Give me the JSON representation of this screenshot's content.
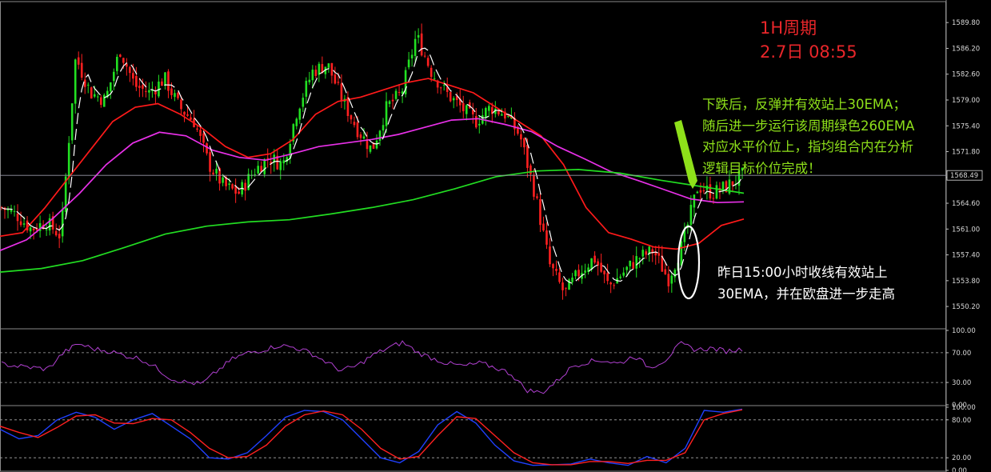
{
  "title": {
    "period": "1H周期",
    "timestamp": "2.7日 08:55"
  },
  "notes": {
    "green": [
      "下跌后，反弹并有效站上30EMA；",
      "随后进一步运行该周期绿色260EMA",
      "对应水平价位上，指均组合内在分析",
      "逻辑目标价位完成！"
    ],
    "white": [
      "昨日15:00小时收线有效站上",
      "30EMA，并在欧盘进一步走高"
    ]
  },
  "colors": {
    "background": "#000000",
    "bull_candle": "#22e022",
    "bear_candle": "#ff2020",
    "ema30": "#ff1a1a",
    "ema_magenta": "#e830e8",
    "ema260": "#22dd22",
    "rsi": "#b040d0",
    "kdj_k": "#2040ff",
    "kdj_d": "#ff2020",
    "green_note": "#8ee01a",
    "title": "#e8262a"
  },
  "chart_data": [
    {
      "type": "candlestick",
      "panel": "price",
      "instrument_timeframe": "1H",
      "ylim": [
        1547.2,
        1592.5
      ],
      "y_ticks": [
        "1589.80",
        "1586.20",
        "1582.60",
        "1579.00",
        "1575.40",
        "1571.80",
        "1568.20",
        "1564.60",
        "1561.00",
        "1557.40",
        "1553.80",
        "1550.20"
      ],
      "current_price": "1568.49",
      "close_path": [
        1564,
        1563,
        1561,
        1562,
        1560,
        1585,
        1580,
        1579,
        1586,
        1581,
        1580,
        1582,
        1578,
        1576,
        1570,
        1567,
        1566,
        1569,
        1571,
        1570,
        1578,
        1583,
        1584,
        1579,
        1575,
        1572,
        1578,
        1580,
        1588,
        1583,
        1580,
        1578,
        1576,
        1578,
        1577,
        1574,
        1566,
        1556,
        1552,
        1555,
        1557,
        1553,
        1555,
        1557,
        1558,
        1554,
        1559,
        1567,
        1566,
        1567,
        1568.5
      ],
      "series": [
        {
          "name": "30EMA",
          "values": [
            1560,
            1560.5,
            1564,
            1568,
            1572,
            1576,
            1578,
            1578.5,
            1577,
            1575,
            1572.5,
            1571,
            1571.5,
            1573.5,
            1577,
            1578.8,
            1579.4,
            1580.4,
            1581.4,
            1582,
            1581,
            1580,
            1578,
            1576,
            1574,
            1570,
            1564,
            1560.5,
            1559.6,
            1558.5,
            1558.2,
            1559,
            1561.5,
            1562.4
          ]
        },
        {
          "name": "magenta EMA",
          "values": [
            1558,
            1559.5,
            1562.5,
            1566,
            1570,
            1573,
            1574.5,
            1574,
            1572,
            1571,
            1570.6,
            1571.5,
            1572.5,
            1573,
            1573.5,
            1574.2,
            1575.2,
            1576.2,
            1576.4,
            1575.6,
            1574.6,
            1572.5,
            1570.8,
            1569,
            1567.8,
            1566.5,
            1565.2,
            1564.7,
            1564.8
          ]
        },
        {
          "name": "260EMA",
          "values": [
            1555,
            1555.5,
            1556.6,
            1558.4,
            1560.3,
            1561.4,
            1562,
            1562.3,
            1563.1,
            1564,
            1565.1,
            1566.6,
            1568.3,
            1569.1,
            1569.3,
            1568.8,
            1567.8,
            1566.9,
            1566
          ]
        }
      ]
    },
    {
      "type": "line",
      "panel": "RSI",
      "ylim": [
        0,
        100
      ],
      "y_ticks": [
        "100.00",
        "70.00",
        "30.00",
        "0.00"
      ],
      "levels": [
        70,
        30
      ],
      "values": [
        55,
        52,
        50,
        48,
        70,
        82,
        75,
        72,
        66,
        62,
        50,
        35,
        30,
        28,
        46,
        62,
        70,
        74,
        80,
        77,
        70,
        58,
        46,
        52,
        66,
        76,
        84,
        70,
        62,
        55,
        52,
        56,
        50,
        42,
        20,
        16,
        32,
        52,
        58,
        60,
        55,
        66,
        50,
        60,
        82,
        74,
        76,
        72,
        75
      ]
    },
    {
      "type": "line",
      "panel": "KDJ",
      "ylim": [
        0,
        100
      ],
      "y_ticks": [
        "100.00",
        "80.00",
        "20.00",
        "0.00"
      ],
      "levels": [
        80,
        20
      ],
      "series": [
        {
          "name": "K",
          "values": [
            65,
            50,
            55,
            80,
            92,
            84,
            65,
            80,
            90,
            70,
            50,
            20,
            18,
            28,
            55,
            84,
            95,
            93,
            80,
            50,
            20,
            12,
            30,
            72,
            93,
            75,
            40,
            15,
            8,
            9,
            10,
            18,
            12,
            8,
            22,
            12,
            35,
            95,
            92,
            97
          ]
        },
        {
          "name": "D",
          "values": [
            70,
            60,
            52,
            68,
            86,
            88,
            75,
            74,
            82,
            80,
            60,
            35,
            20,
            22,
            40,
            70,
            88,
            94,
            88,
            65,
            35,
            18,
            22,
            55,
            85,
            82,
            55,
            28,
            12,
            9,
            9,
            14,
            14,
            11,
            16,
            16,
            28,
            80,
            90,
            96
          ]
        }
      ]
    }
  ]
}
